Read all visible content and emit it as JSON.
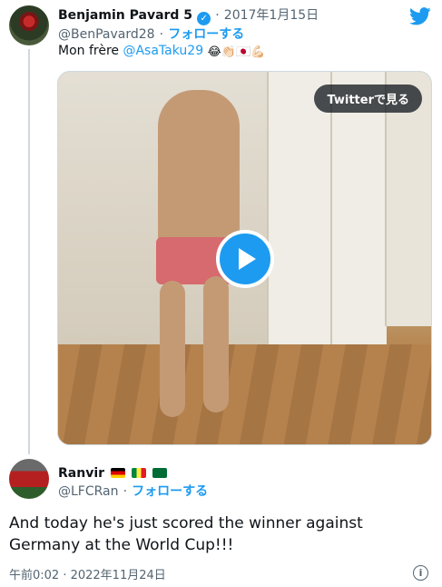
{
  "tweet1": {
    "author_name": "Benjamin Pavard 5",
    "date": "2017年1月15日",
    "handle": "@BenPavard28",
    "follow_label": "フォローする",
    "text_prefix": "Mon frère",
    "mention": "@AsaTaku29",
    "emojis": "😂👏🏻🇯🇵💪🏻",
    "media": {
      "watch_button": "Twitterで見る",
      "type": "video"
    }
  },
  "tweet2": {
    "author_name": "Ranvir",
    "handle": "@LFCRan",
    "follow_label": "フォローする",
    "text": "And today he's just scored the winner against Germany at the World Cup!!!",
    "timestamp": "午前0:02 · 2022年11月24日"
  },
  "separator": "·",
  "colors": {
    "link": "#1d9bf0",
    "muted": "#536471",
    "text": "#0f1419"
  },
  "icons": {
    "verified": "verified-badge-icon",
    "twitter": "twitter-bird-icon",
    "play": "play-icon",
    "info": "info-icon"
  }
}
